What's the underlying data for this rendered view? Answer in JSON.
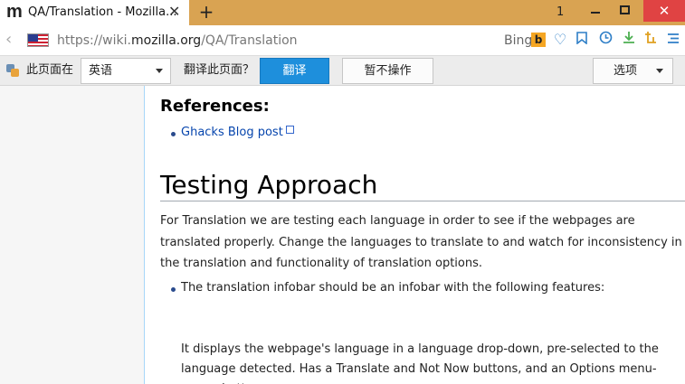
{
  "tab": {
    "logo": "m",
    "title": "QA/Translation - Mozilla...",
    "close": "✕",
    "new_tab": "+"
  },
  "window": {
    "tab_count": "1",
    "close": "✕"
  },
  "navbar": {
    "url_prefix": "https://wiki.",
    "url_domain": "mozilla.org",
    "url_path": "/QA/Translation",
    "search_engine": "Bing",
    "search_badge": "b",
    "back": "‹"
  },
  "infobar": {
    "this_page_in": "此页面在",
    "language": "英语",
    "translate_question": "翻译此页面？",
    "translate_button": "翻译",
    "not_now_button": "暂不操作",
    "options_button": "选项"
  },
  "content": {
    "references_heading": "References:",
    "reference_link": "Ghacks Blog post",
    "section_heading": "Testing Approach",
    "paragraph": "For Translation we are testing each language in order to see if the webpages are translated properly. Change the languages to translate to and watch for inconsistency in the translation and functionality of translation options.",
    "list_item": "The translation infobar should be an infobar with the following features:",
    "list_description": "It displays the webpage's language in a language drop-down, pre-selected to the language detected. Has a Translate and Not Now buttons, and an Options menu-popup button"
  },
  "colors": {
    "titlebar": "#d9a352",
    "primary_button": "#1e8fdc",
    "link": "#0645ad",
    "window_close": "#e04343"
  }
}
